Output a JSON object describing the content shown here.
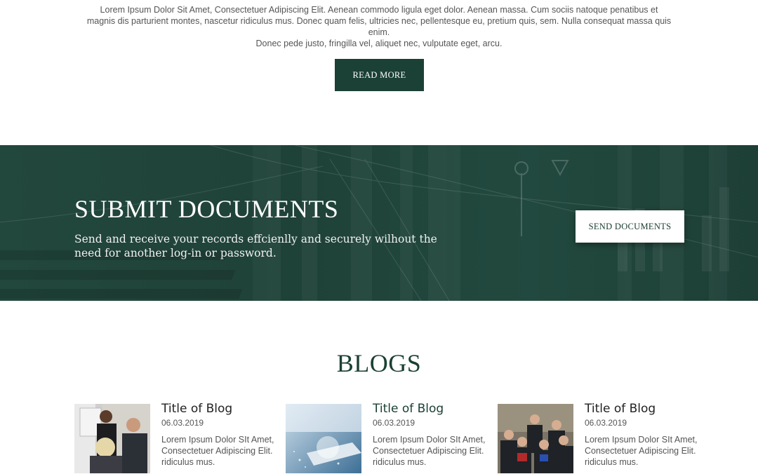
{
  "intro": {
    "lines": [
      "Lorem Ipsum Dolor Sit Amet, Consectetuer Adipiscing Elit. Aenean commodo ligula eget dolor. Aenean massa. Cum sociis natoque penatibus et",
      "magnis dis parturient montes, nascetur ridiculus mus. Donec quam felis, ultricies nec, pellentesque eu, pretium quis, sem. Nulla consequat massa quis enim.",
      "Donec pede justo, fringilla vel, aliquet nec, vulputate eget, arcu."
    ],
    "button_label": "READ MORE"
  },
  "banner": {
    "title": "SUBMIT DOCUMENTS",
    "text": "Send and receive your records effcienlly and securely wilhout the need for another log-in or password.",
    "button_label": "SEND DOCUMENTS"
  },
  "blogs": {
    "heading": "BLOGS",
    "items": [
      {
        "title": "Title of Blog",
        "date": "06.03.2019",
        "excerpt": "Lorem Ipsum Dolor SIt Amet, Consectetuer Adipiscing Elit. ridiculus mus."
      },
      {
        "title": "Title of Blog",
        "date": "06.03.2019",
        "excerpt": "Lorem Ipsum Dolor SIt Amet, Consectetuer Adipiscing Elit. ridiculus mus."
      },
      {
        "title": "Title of Blog",
        "date": "06.03.2019",
        "excerpt": "Lorem Ipsum Dolor SIt Amet, Consectetuer Adipiscing Elit. ridiculus mus."
      }
    ]
  },
  "colors": {
    "brand_green": "#1b4036",
    "white": "#ffffff",
    "text_gray": "#555555"
  }
}
